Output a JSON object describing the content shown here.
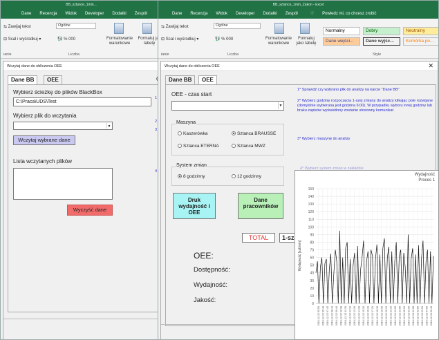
{
  "back_window": {
    "title": "BB_sztance_1min...",
    "tabs": [
      "Dane",
      "Recenzja",
      "Widok",
      "Developer",
      "Dodatki",
      "Zespół",
      "ułu"
    ],
    "ribbon": {
      "wrap": "Zawijaj tekst",
      "merge": "Scal i wyśrodkuj",
      "number_format": "Ogólne",
      "number_symbols": "% 000",
      "cond_format": "Formatowanie warunkowe",
      "format_table": "Formatuj jak tabelę",
      "group_align": "ianie",
      "group_number": "Liczba"
    },
    "form": {
      "title": "Wczytaj dane do obliczenia OEE",
      "tabs": [
        "Dane BB",
        "OEE"
      ],
      "tab_edge": "G",
      "path_label": "Wybierz ścieżkę do plików BlackBox",
      "path_value": "C:\\Praca\\UDS\\Test",
      "file_label": "Wybierz plik do wczytania",
      "file_value": "",
      "load_button": "Wczytaj wybrane dane",
      "list_label": "Lista wczytanych plików",
      "clear_button": "Wyczyść dane",
      "edge_hints": [
        "1",
        "2",
        "3",
        "4"
      ]
    }
  },
  "front_window": {
    "title": "BB_sztance_1min_Zakon - Excel",
    "tabs": [
      "Dane",
      "Recenzja",
      "Widok",
      "Developer",
      "Dodatki",
      "Zespół"
    ],
    "tell_me": "Powiedz mi, co chcesz zrobić",
    "ribbon": {
      "wrap": "Zawijaj tekst",
      "merge": "Scal i wyśrodkuj",
      "number_format": "Ogólne",
      "number_symbols": "% 000",
      "cond_format": "Formatowanie warunkowe",
      "format_table": "Formatuj jako tabelę",
      "group_align": "ianie",
      "group_number": "Liczba",
      "group_styles": "Style",
      "styles": [
        {
          "label": "Normalny",
          "bg": "#ffffff",
          "fg": "#000000"
        },
        {
          "label": "Dobry",
          "bg": "#c6efce",
          "fg": "#006100"
        },
        {
          "label": "Neutralny",
          "bg": "#ffeb9c",
          "fg": "#9c5700"
        },
        {
          "label": "Dane wejści...",
          "bg": "#ffcc99",
          "fg": "#3f3f76"
        },
        {
          "label": "Dane wyjśc...",
          "bg": "#f2f2f2",
          "fg": "#3f3f3f"
        },
        {
          "label": "Komórka po...",
          "bg": "#f2f2f2",
          "fg": "#fa7d00"
        }
      ]
    },
    "form": {
      "title": "Wczytaj dane do obliczenia OEE",
      "tabs": [
        "Dane BB",
        "OEE"
      ],
      "oee_time_label": "OEE - czas start",
      "oee_time_value": "",
      "machine_label": "Maszyna",
      "machines": [
        {
          "label": "Kaszerówka",
          "on": false
        },
        {
          "label": "Sztanca BRAUSSE",
          "on": true
        },
        {
          "label": "Sztanca ETERNA",
          "on": false
        },
        {
          "label": "Sztanca MWZ",
          "on": false
        }
      ],
      "shift_label": "System zmian",
      "shifts": [
        {
          "label": "8 godzinny",
          "on": true
        },
        {
          "label": "12 godzinny",
          "on": false
        }
      ],
      "print_button": "Druk wydajność i OEE",
      "workers_button": "Dane pracowników",
      "total_label": "TOTAL",
      "shift_first": "1-sza",
      "oee_label": "OEE:",
      "availability_label": "Dostępność:",
      "performance_label": "Wydajność:",
      "quality_label": "Jakość:",
      "instructions": [
        "1* Sprawdź czy wybrano plik do analizy na karcie \"Dane BB\"",
        "2* Wybierz godzinę rozpoczęcia 1-szej zmiany do analizy klikając pole rozwijane (domyślnie wybierana jest godzina 6:00). W przypadku wyboru innej godziny lub braku zapisów wyświetlony zostanie stosowny komunikat",
        "3* Wybierz maszynę do analizy",
        "4* Wybierz system zmian w zakładzie"
      ],
      "close_icon": "close-icon"
    }
  },
  "chart_data": {
    "type": "line",
    "title": "Wydajność",
    "subtitle": "Proces 1",
    "ylabel": "Wydajność [szt/min]",
    "xlabel": "",
    "ylim": [
      0,
      150
    ],
    "yticks": [
      0,
      10,
      20,
      30,
      40,
      50,
      60,
      70,
      80,
      90,
      100,
      110,
      120,
      130,
      140,
      150
    ],
    "grid": true,
    "x": [
      "2016-12-12 05:50",
      "2016-12-12 06:48",
      "2016-12-12 07:45",
      "2016-12-12 08:43",
      "2016-12-12 09:40",
      "2016-12-12 10:38",
      "2016-12-12 11:35",
      "2016-12-12 12:33",
      "2016-12-12 13:30",
      "2016-12-12 14:28",
      "2016-12-12 15:25",
      "2016-12-12 16:23",
      "2016-12-12 17:20",
      "2016-12-12 18:18",
      "2016-12-12 19:15",
      "2016-12-12 20:13",
      "2016-12-12 21:10",
      "2016-12-12 22:08",
      "2016-12-12 23:05",
      "2016-12-13 00:03",
      "2016-12-13 01:00",
      "2016-12-13 01:58",
      "2016-12-13 02:55",
      "2016-12-13 03:53",
      "2016-12-13 04:50",
      "2016-12-13 05:48"
    ],
    "series": [
      {
        "values": [
          40,
          55,
          0,
          48,
          60,
          0,
          52,
          58,
          0,
          45,
          65,
          0,
          38,
          70,
          55,
          0,
          95,
          0,
          60,
          0,
          72,
          80,
          0,
          58,
          0,
          50,
          66,
          0,
          75,
          0,
          44,
          60,
          82,
          0,
          55,
          68,
          0,
          70,
          62,
          0,
          58,
          77,
          0,
          64,
          0,
          72,
          85,
          0,
          60,
          74,
          0,
          68,
          0,
          56,
          80,
          0,
          62,
          70,
          0,
          66,
          48,
          0,
          90,
          0,
          58,
          72,
          0,
          64,
          0,
          76,
          0,
          60,
          82,
          0,
          54,
          70,
          0,
          68,
          0,
          62
        ]
      }
    ]
  }
}
